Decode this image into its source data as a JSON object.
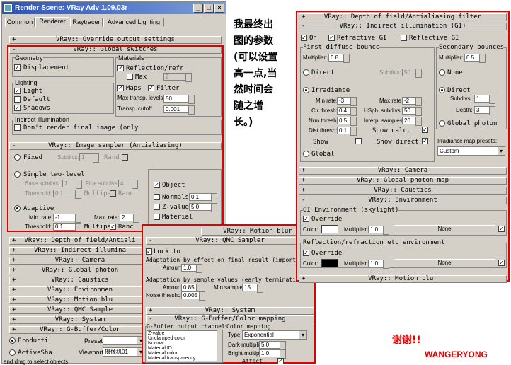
{
  "left_window": {
    "title": "Render Scene: VRay Adv 1.09.03r",
    "tabs": [
      "Common",
      "Renderer",
      "Raytracer",
      "Advanced Lighting"
    ],
    "rollouts": {
      "override": "VRay:: Override output settings",
      "global_switches": "VRay:: Global switches",
      "image_sampler": "VRay:: Image sampler (Antialiasing)",
      "dof": "VRay:: Depth of field/Antiali",
      "indirect": "VRay:: Indirect illumina",
      "camera": "VRay:: Camera",
      "photon": "VRay:: Global photon",
      "caustics": "VRay:: Caustics",
      "environment": "VRay:: Environmen",
      "motion_blur": "VRay:: Motion blu",
      "qmc": "VRay:: QMC Sample",
      "system": "VRay:: System",
      "gbuffer": "VRay:: G-Buffer/Color"
    },
    "geometry": {
      "label": "Geometry",
      "displacement": "Displacement"
    },
    "materials": {
      "label": "Materials",
      "reflection": "Reflection/refr",
      "max": "Max",
      "max_val": "2",
      "maps": "Maps",
      "filter": "Filter",
      "max_transp_label": "Max transp. levels",
      "max_transp": "50",
      "transp_cutoff_label": "Transp. cutoff",
      "transp_cutoff": "0.001"
    },
    "lighting": {
      "label": "Lighting",
      "light": "Light",
      "default": "Default",
      "shadows": "Shadows"
    },
    "indirect_illum": {
      "label": "Indirect illumination",
      "dont_render": "Don't render final image (only"
    },
    "sampler": {
      "fixed": "Fixed",
      "subdivs": "Subdivs:",
      "subdivs_val": "1",
      "rand": "Rand",
      "two_level": "Simple two-level",
      "base_subdivs": "Base subdivs:",
      "base_val": "1",
      "fine_subdivs": "Fine subdivs:",
      "fine_val": "4",
      "threshold": "Threshold:",
      "threshold_val": "0.1",
      "multipass": "Multipa",
      "randc": "Ranc",
      "adaptive": "Adaptive",
      "min_rate": "Min. rate:",
      "min_rate_val": "-1",
      "max_rate": "Max. rate:",
      "max_rate_val": "2",
      "ad_threshold": "Threshold:",
      "ad_threshold_val": "0.1",
      "object": "Object",
      "normals": "Normals",
      "normals_val": "0.1",
      "zvalue": "Z-value",
      "zvalue_val": "5.0",
      "material": "Material"
    },
    "footer": {
      "production": "Producti",
      "activeshade": "ActiveSha",
      "preset_label": "Preset:",
      "viewport_label": "Viewport:",
      "viewport_val": "摄像机01"
    },
    "status": "and drag to select objects"
  },
  "mid_window": {
    "motion_blur": "VRay:: Motion blur",
    "qmc": "VRay:: QMC Sampler",
    "lock": "Lock to",
    "adapt_effect": "Adaptation by effect on final result (importance samp",
    "amount1_label": "Amount:",
    "amount1": "1.0",
    "adapt_sample": "Adaptation by sample values (early termination)",
    "amount2_label": "Amount:",
    "amount2": "0.85",
    "min_samples_label": "Min samples:",
    "min_samples": "15",
    "noise_label": "Noise threshold:",
    "noise": "0.005",
    "system": "VRay:: System",
    "gbuffer": "VRay:: G-Buffer/Color mapping",
    "gbuffer_channels": "G-Buffer output channels",
    "channels": [
      "Z-value",
      "Unclamped color",
      "Normal",
      "Material ID",
      "Material color",
      "Material transparency"
    ],
    "color_mapping": "Color mapping",
    "type_label": "Type:",
    "type_val": "Exponential",
    "dark_label": "Dark multiplier:",
    "dark_val": "5.0",
    "bright_label": "Bright multiplier:",
    "bright_val": "1.0",
    "affect": "Affect"
  },
  "right_window": {
    "dof": "VRay:: Depth of field/Antialiasing filter",
    "indirect": "VRay:: Indirect illumination (GI)",
    "on": "On",
    "refractive_gi": "Refractive GI",
    "reflective_gi": "Reflective GI",
    "first_bounce": "First diffuse bounce",
    "multiplier_label": "Multiplier:",
    "multiplier": "0.8",
    "secondary": "Secondary bounces",
    "sec_multiplier": "0.5",
    "direct": "Direct",
    "subdivs_label": "Subdivs:",
    "subdivs": "50",
    "none": "None",
    "irradiance": "Irradiance",
    "min_rate_label": "Min rate:",
    "min_rate": "-3",
    "max_rate_label": "Max rate:",
    "max_rate": "-2",
    "clr_label": "Clr thresh:",
    "clr": "0.4",
    "hsph_label": "HSph. subdivs:",
    "hsph": "50",
    "nrm_label": "Nrm thresh:",
    "nrm": "0.5",
    "interp_label": "Interp. samples:",
    "interp": "20",
    "dist_label": "Dist thresh:",
    "dist": "0.1",
    "show_calc": "Show calc.",
    "show": "Show",
    "show_direct": "Show direct",
    "global": "Global",
    "direct2": "Direct",
    "subdivs2_label": "Subdivs:",
    "subdivs2": "1",
    "depth_label": "Depth:",
    "depth": "3",
    "global_photon": "Global photon",
    "irr_presets_label": "Irradiance map presets:",
    "irr_presets": "Custom",
    "camera": "VRay:: Camera",
    "photon_map": "VRay:: Global photon map",
    "caustics": "VRay:: Caustics",
    "environment": "VRay:: Environment",
    "gi_env": "GI Environment (skylight)",
    "override": "Override",
    "color_label": "Color:",
    "mult_label": "Multiplier:",
    "mult1": "1.0",
    "none_btn": "None",
    "refl_env": "Reflection/refraction etc environment",
    "override2": "Override",
    "mult2": "1.0",
    "none_btn2": "None",
    "motion_blur": "VRay:: Motion blur"
  },
  "annotation": {
    "lines": [
      "我最终出",
      "图的参数",
      "(可以设置",
      "高一点,当",
      "然时间会",
      "随之增",
      "长。)"
    ],
    "thanks": "谢谢!!",
    "author": "WANGERYONG"
  },
  "colors": {
    "highlight": "#e00000",
    "title_bar": "#2a52be",
    "panel": "#d4d0c8"
  }
}
